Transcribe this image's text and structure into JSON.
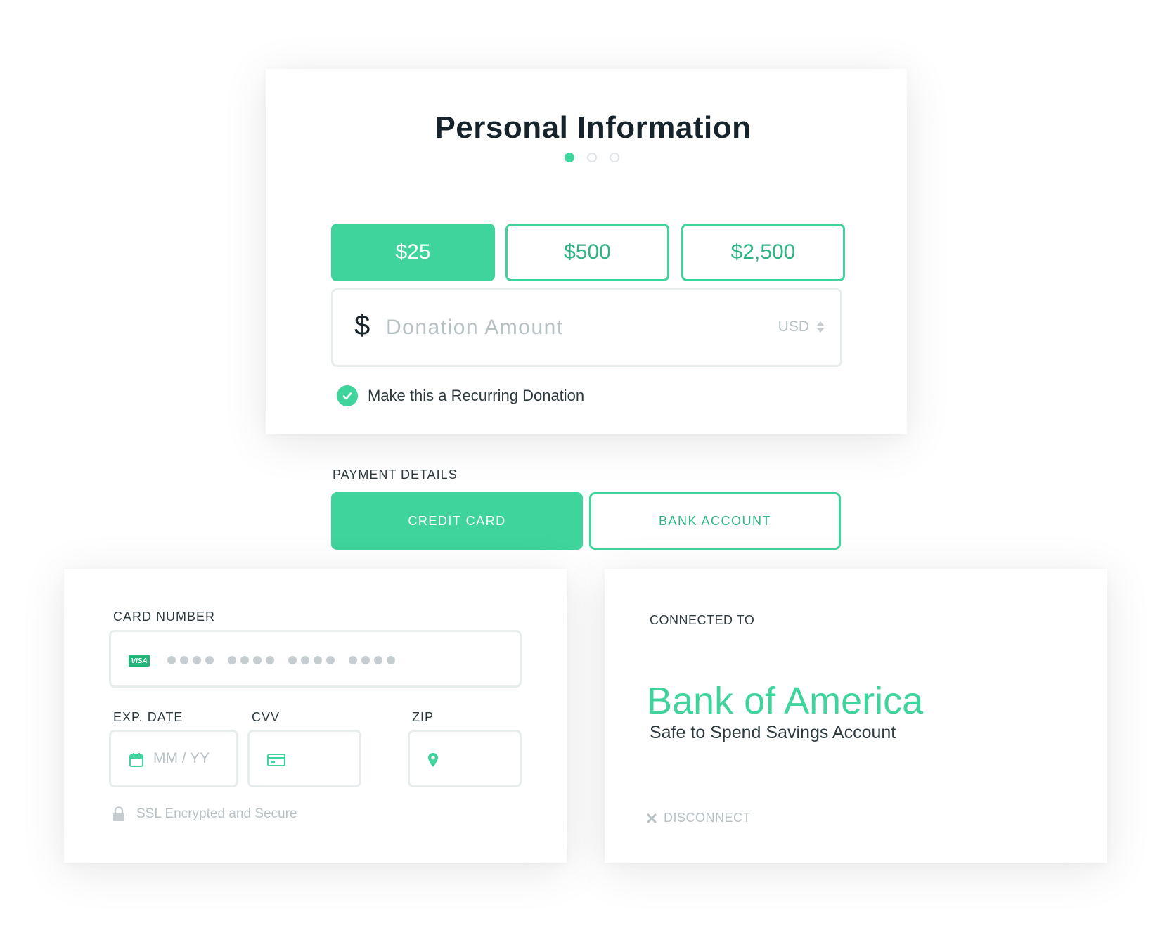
{
  "header": {
    "title": "Personal Information",
    "steps": {
      "current": 1,
      "total": 3
    }
  },
  "amounts": {
    "options": [
      "$25",
      "$500",
      "$2,500"
    ],
    "selected": "$25"
  },
  "donation": {
    "currency_symbol": "$",
    "placeholder": "Donation Amount",
    "currency": "USD"
  },
  "recurring": {
    "label": "Make this a Recurring Donation",
    "checked": true
  },
  "payment": {
    "section_label": "PAYMENT DETAILS",
    "tabs": [
      "CREDIT CARD",
      "BANK ACCOUNT"
    ],
    "active_tab": "CREDIT CARD"
  },
  "credit_card": {
    "card_number_label": "CARD NUMBER",
    "card_brand": "VISA",
    "card_number_mask": "•••• •••• •••• ••••",
    "exp_label": "EXP. DATE",
    "exp_placeholder": "MM / YY",
    "cvv_label": "CVV",
    "zip_label": "ZIP",
    "security_note": "SSL Encrypted and Secure"
  },
  "bank": {
    "connected_label": "CONNECTED TO",
    "bank_name": "Bank of America",
    "account_name": "Safe to Spend Savings Account",
    "disconnect_label": "DISCONNECT"
  },
  "colors": {
    "accent": "#3fd49c",
    "accent_text": "#2fb583",
    "placeholder": "#b7c1c4",
    "border": "#e7eced"
  },
  "icons": [
    "check-icon",
    "updown-caret-icon",
    "visa-icon",
    "calendar-icon",
    "credit-card-icon",
    "map-pin-icon",
    "lock-icon",
    "close-x-icon"
  ]
}
